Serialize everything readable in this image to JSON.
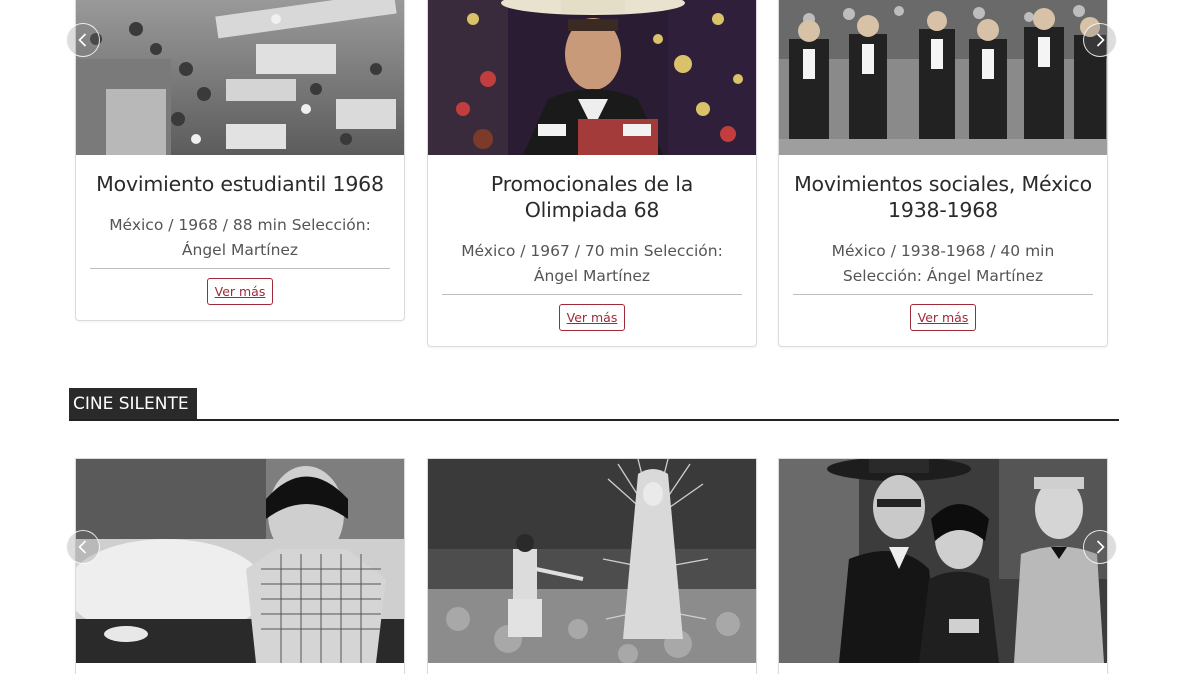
{
  "carousel_top": {
    "cards": [
      {
        "title": "Movimiento estudiantil 1968",
        "meta": "México / 1968 / 88 min Selección: Ángel Martínez",
        "button": "Ver más",
        "image": "black-and-white photo of a student protest crowd with banners"
      },
      {
        "title": "Promocionales de la Olimpiada 68",
        "meta": "México / 1967 / 70 min Selección: Ángel Martínez",
        "button": "Ver más",
        "image": "color photo of a man in a charro sombrero in front of a decorated dark wall"
      },
      {
        "title": "Movimientos sociales, México 1938-1968",
        "meta": "México / 1938-1968 / 40 min Selección: Ángel Martínez",
        "button": "Ver más",
        "image": "black-and-white photo of men in suits marching in a street"
      }
    ],
    "prev_icon": "chevron-left-icon",
    "next_icon": "chevron-right-icon"
  },
  "section": {
    "title": "CINE SILENTE"
  },
  "carousel_bottom": {
    "cards": [
      {
        "image": "black-and-white still of a woman in a checkered dress lying on a bed"
      },
      {
        "image": "black-and-white still of an apparition of the Virgin of Guadalupe on a rocky hillside"
      },
      {
        "image": "black-and-white still of a man in a hat embracing a woman, another man behind"
      }
    ],
    "prev_icon": "chevron-left-icon",
    "next_icon": "chevron-right-icon"
  },
  "colors": {
    "accent": "#a0293a",
    "section_label_bg": "#2a2a2a",
    "card_border": "#dcdcdc"
  }
}
